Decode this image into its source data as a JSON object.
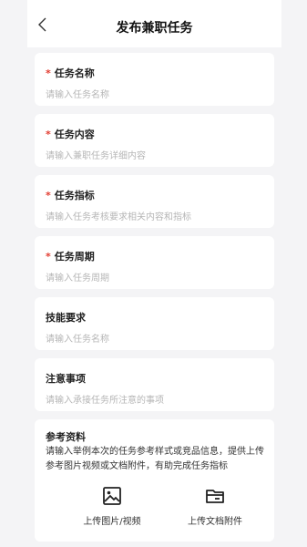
{
  "header": {
    "title": "发布兼职任务"
  },
  "fields": [
    {
      "label": "任务名称",
      "required": true,
      "placeholder": "请输入任务名称"
    },
    {
      "label": "任务内容",
      "required": true,
      "placeholder": "请输入兼职任务详细内容"
    },
    {
      "label": "任务指标",
      "required": true,
      "placeholder": "请输入任务考核要求相关内容和指标"
    },
    {
      "label": "任务周期",
      "required": true,
      "placeholder": "请输入任务周期"
    },
    {
      "label": "技能要求",
      "required": false,
      "placeholder": "请输入任务名称"
    },
    {
      "label": "注意事项",
      "required": false,
      "placeholder": "请输入承接任务所注意的事项"
    }
  ],
  "reference": {
    "label": "参考资料",
    "description": "请输入举例本次的任务参考样式或竞品信息，提供上传参考图片视频或文档附件，有助完成任务指标",
    "upload_media_label": "上传图片/视频",
    "upload_doc_label": "上传文档附件"
  },
  "required_mark": "*"
}
